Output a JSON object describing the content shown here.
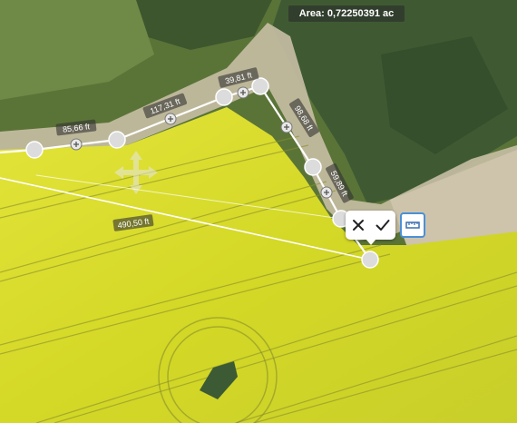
{
  "area": {
    "label": "Area: 0,72250391 ac"
  },
  "segments": [
    {
      "label": "85,66 ft"
    },
    {
      "label": "117,31 ft"
    },
    {
      "label": "39,81 ft"
    },
    {
      "label": "98,68 ft"
    },
    {
      "label": "59,89 ft"
    },
    {
      "label": "490,50 ft"
    }
  ],
  "popup": {
    "cancel_icon": "close-icon",
    "confirm_icon": "check-icon"
  },
  "ruler_button": {
    "icon": "ruler-icon",
    "accent": "#4a90d9"
  },
  "colors": {
    "field": "#d9dc2a",
    "grass": "#5f7a3c",
    "trees": "#3d5a32",
    "track": "#c9c0a8",
    "line": "#ffffff"
  }
}
